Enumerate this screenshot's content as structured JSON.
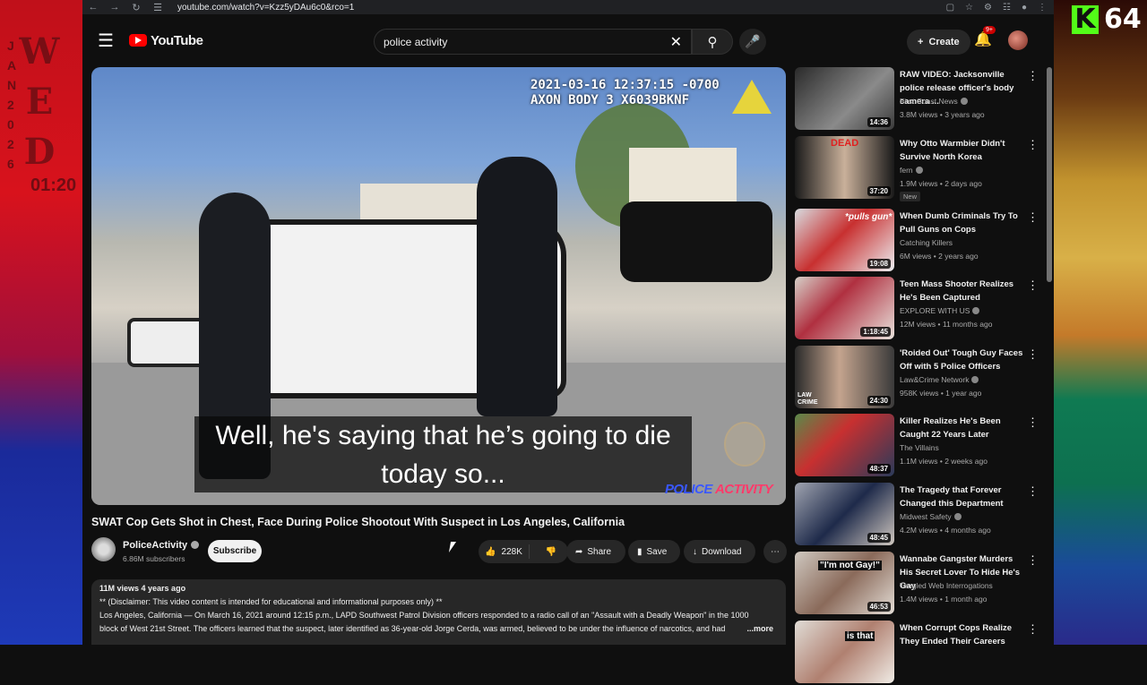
{
  "stream": {
    "left_overlay_letters": [
      "W",
      "E",
      "D"
    ],
    "left_overlay_date_letters": [
      "J",
      "A",
      "N",
      "2",
      "0",
      "2",
      "6"
    ],
    "left_overlay_time": "01:20",
    "kick_count": "64"
  },
  "browser": {
    "url": "youtube.com/watch?v=Kzz5yDAu6c0&rco=1"
  },
  "header": {
    "logo_text": "YouTube",
    "search_value": "police activity",
    "create_label": "Create",
    "notification_badge": "9+"
  },
  "video": {
    "timestamp_line1": "2021-03-16 12:37:15 -0700",
    "timestamp_line2": "AXON BODY 3 X6039BKNF",
    "caption_line1": "Well, he's saying that he’s going to die",
    "caption_line2": "today so...",
    "watermark_a": "POLICE",
    "watermark_b": "ACTIVITY",
    "title": "SWAT Cop Gets Shot in Chest, Face During Police Shootout With Suspect in Los Angeles, California"
  },
  "channel": {
    "name": "PoliceActivity",
    "subscribers": "6.86M subscribers",
    "subscribe_label": "Subscribe"
  },
  "actions": {
    "likes": "228K",
    "share_label": "Share",
    "save_label": "Save",
    "download_label": "Download"
  },
  "description": {
    "meta": "11M views  4 years ago",
    "line1": "** (Disclaimer: This video content is intended for educational and informational purposes only) **",
    "line2": "Los Angeles, California — On March 16, 2021 around 12:15 p.m., LAPD Southwest Patrol Division officers responded to a radio call of an \"Assault with a Deadly Weapon\" in the 1000",
    "line3": "block of West 21st Street. The officers learned that the suspect, later identified as 36-year-old Jorge Cerda, was armed, believed to be under the influence of narcotics, and had",
    "more_label": "...more"
  },
  "recommendations": [
    {
      "title": "RAW VIDEO: Jacksonville police release officer's body camera ...",
      "channel": "First Coast News",
      "stats": "3.8M views • 3 years ago",
      "duration": "14:36",
      "thumb_text": "",
      "new": ""
    },
    {
      "title": "Why Otto Warmbier Didn't Survive North Korea",
      "channel": "fern",
      "stats": "1.9M views • 2 days ago",
      "duration": "37:20",
      "thumb_text": "DEAD",
      "new": "New"
    },
    {
      "title": "When Dumb Criminals Try To Pull Guns on Cops",
      "channel": "Catching Killers",
      "stats": "6M views • 2 years ago",
      "duration": "19:08",
      "thumb_text": "*pulls gun*",
      "new": ""
    },
    {
      "title": "Teen Mass Shooter Realizes He's Been Captured",
      "channel": "EXPLORE WITH US",
      "stats": "12M views • 11 months ago",
      "duration": "1:18:45",
      "thumb_text": "",
      "new": ""
    },
    {
      "title": "'Roided Out' Tough Guy Faces Off with 5 Police Officers",
      "channel": "Law&Crime Network",
      "stats": "958K views • 1 year ago",
      "duration": "24:30",
      "thumb_text": "LAW CRIME",
      "new": ""
    },
    {
      "title": "Killer Realizes He's Been Caught 22 Years Later",
      "channel": "The Villains",
      "stats": "1.1M views • 2 weeks ago",
      "duration": "48:37",
      "thumb_text": "",
      "new": ""
    },
    {
      "title": "The Tragedy that Forever Changed this Department",
      "channel": "Midwest Safety",
      "stats": "4.2M views • 4 months ago",
      "duration": "48:45",
      "thumb_text": "",
      "new": ""
    },
    {
      "title": "Wannabe Gangster Murders His Secret Lover To Hide He's Gay",
      "channel": "Tangled Web Interrogations",
      "stats": "1.4M views • 1 month ago",
      "duration": "46:53",
      "thumb_text": "\"I'm not Gay!\"",
      "new": ""
    },
    {
      "title": "When Corrupt Cops Realize They Ended Their Careers",
      "channel": "",
      "stats": "",
      "duration": "",
      "thumb_text": "is that",
      "new": ""
    }
  ]
}
